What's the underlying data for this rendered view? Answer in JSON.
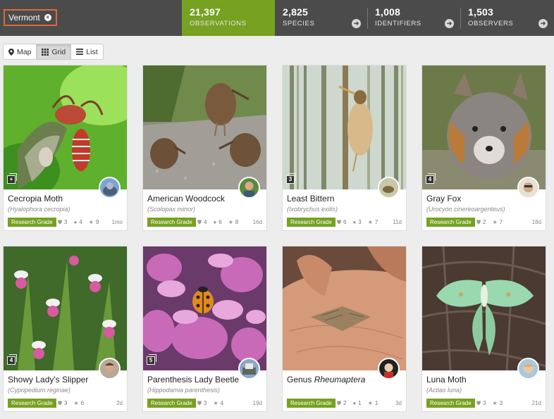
{
  "place_filter": {
    "label": "Vermont",
    "remove_icon": "close-circle-icon"
  },
  "stats": [
    {
      "number": "21,397",
      "label": "OBSERVATIONS",
      "active": true
    },
    {
      "number": "2,825",
      "label": "SPECIES",
      "arrow_icon": "arrow-right-circle-icon"
    },
    {
      "number": "1,008",
      "label": "IDENTIFIERS",
      "arrow_icon": "arrow-right-circle-icon"
    },
    {
      "number": "1,503",
      "label": "OBSERVERS",
      "arrow_icon": "arrow-right-circle-icon"
    }
  ],
  "views": [
    {
      "label": "Map",
      "icon": "map-pin-icon"
    },
    {
      "label": "Grid",
      "icon": "grid-icon",
      "selected": true
    },
    {
      "label": "List",
      "icon": "list-icon"
    }
  ],
  "accent_color": "#76a121",
  "topbar_color": "#4b4b4b",
  "observations": [
    {
      "common_name": "Cecropia Moth",
      "scientific_name": "(Hyalophora cecropia)",
      "grade": "Research Grade",
      "ids": "3",
      "comments": "4",
      "faves": "9",
      "age": "1mo",
      "photo_count": "+"
    },
    {
      "common_name": "American Woodcock",
      "scientific_name": "(Scolopax minor)",
      "grade": "Research Grade",
      "ids": "4",
      "comments": "6",
      "faves": "8",
      "age": "16d",
      "photo_count": ""
    },
    {
      "common_name": "Least Bittern",
      "scientific_name": "(Ixobrychus exilis)",
      "grade": "Research Grade",
      "ids": "6",
      "comments": "3",
      "faves": "7",
      "age": "11d",
      "photo_count": "3"
    },
    {
      "common_name": "Gray Fox",
      "scientific_name": "(Urocyon cinereoargenteus)",
      "grade": "Research Grade",
      "ids": "2",
      "comments": "",
      "faves": "7",
      "age": "18d",
      "photo_count": "4"
    },
    {
      "common_name": "Showy Lady's Slipper",
      "scientific_name": "(Cypripedium reginae)",
      "grade": "Research Grade",
      "ids": "3",
      "comments": "",
      "faves": "6",
      "age": "2d",
      "photo_count": "4"
    },
    {
      "common_name": "Parenthesis Lady Beetle",
      "scientific_name": "(Hippodamia parenthesis)",
      "grade": "Research Grade",
      "ids": "3",
      "comments": "",
      "faves": "4",
      "age": "19d",
      "photo_count": "5"
    },
    {
      "common_name_prefix": "Genus ",
      "common_name_italic": "Rheumaptera",
      "scientific_name": "",
      "grade": "Research Grade",
      "ids": "2",
      "comments": "1",
      "faves": "1",
      "age": "3d",
      "photo_count": ""
    },
    {
      "common_name": "Luna Moth",
      "scientific_name": "(Actias luna)",
      "grade": "Research Grade",
      "ids": "3",
      "comments": "",
      "faves": "3",
      "age": "21d",
      "photo_count": ""
    }
  ]
}
